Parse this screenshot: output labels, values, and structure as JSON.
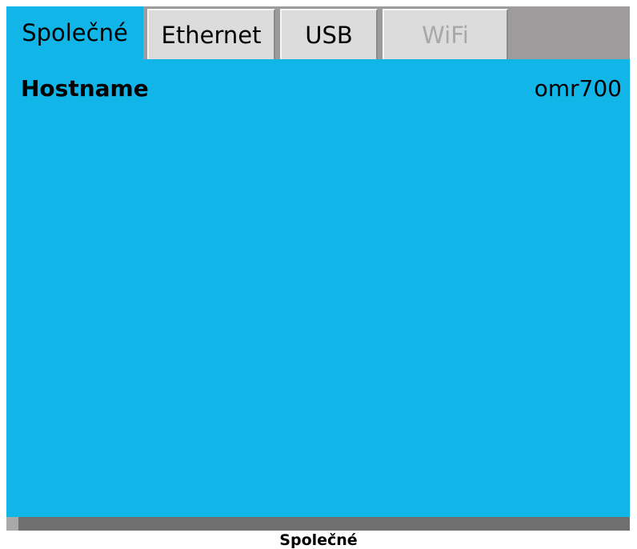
{
  "tabs": [
    {
      "label": "Společné",
      "state": "active"
    },
    {
      "label": "Ethernet",
      "state": "normal"
    },
    {
      "label": "USB",
      "state": "normal"
    },
    {
      "label": "WiFi",
      "state": "disabled"
    }
  ],
  "panel": {
    "hostname_label": "Hostname",
    "hostname_value": "omr700"
  },
  "caption": "Společné",
  "colors": {
    "accent": "#12b5e7",
    "frame": "#9d9b9c",
    "tab_inactive": "#dcdcdc",
    "disabled_text": "#a8a8a8"
  }
}
